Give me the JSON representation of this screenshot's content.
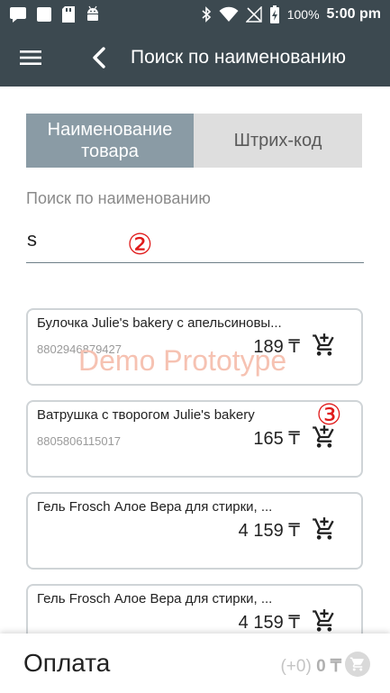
{
  "status_bar": {
    "battery": "100%",
    "time": "5:00 pm",
    "left_icons": [
      "message-icon",
      "notification-square-icon",
      "sd-card-icon",
      "android-icon"
    ],
    "right_icons": [
      "bluetooth-icon",
      "wifi-icon",
      "no-signal-icon",
      "battery-charging-icon"
    ]
  },
  "app_bar": {
    "title": "Поиск по наименованию",
    "menu_icon": "hamburger-menu-icon",
    "back_icon": "chevron-left-icon"
  },
  "tabs": [
    {
      "label": "Наименование товара",
      "active": true
    },
    {
      "label": "Штрих-код",
      "active": false
    }
  ],
  "search": {
    "label": "Поиск по наименованию",
    "value": "s"
  },
  "annotations": [
    "②",
    "③"
  ],
  "watermark": "Demo Prototype",
  "products": [
    {
      "name": "Булочка Julie's bakery с апельсиновы...",
      "barcode": "8802946879427",
      "price": "189 ₸"
    },
    {
      "name": "Ватрушка с творогом Julie's bakery",
      "barcode": "8805806115017",
      "price": "165 ₸"
    },
    {
      "name": "Гель Frosch Алое Вера для стирки, ...",
      "barcode": "",
      "price": "4 159 ₸"
    },
    {
      "name": "Гель Frosch Алое Вера для стирки, ...",
      "barcode": "",
      "price": "4 159 ₸"
    }
  ],
  "bottom_bar": {
    "pay_label": "Оплата",
    "added": "(+0)",
    "total": "0 ₸"
  },
  "colors": {
    "app_bar": "#3c4950",
    "tab_active": "#8a9ba5",
    "tab_inactive": "#dedede",
    "annotation": "#e01a1a",
    "watermark": "#f6c2b2"
  }
}
